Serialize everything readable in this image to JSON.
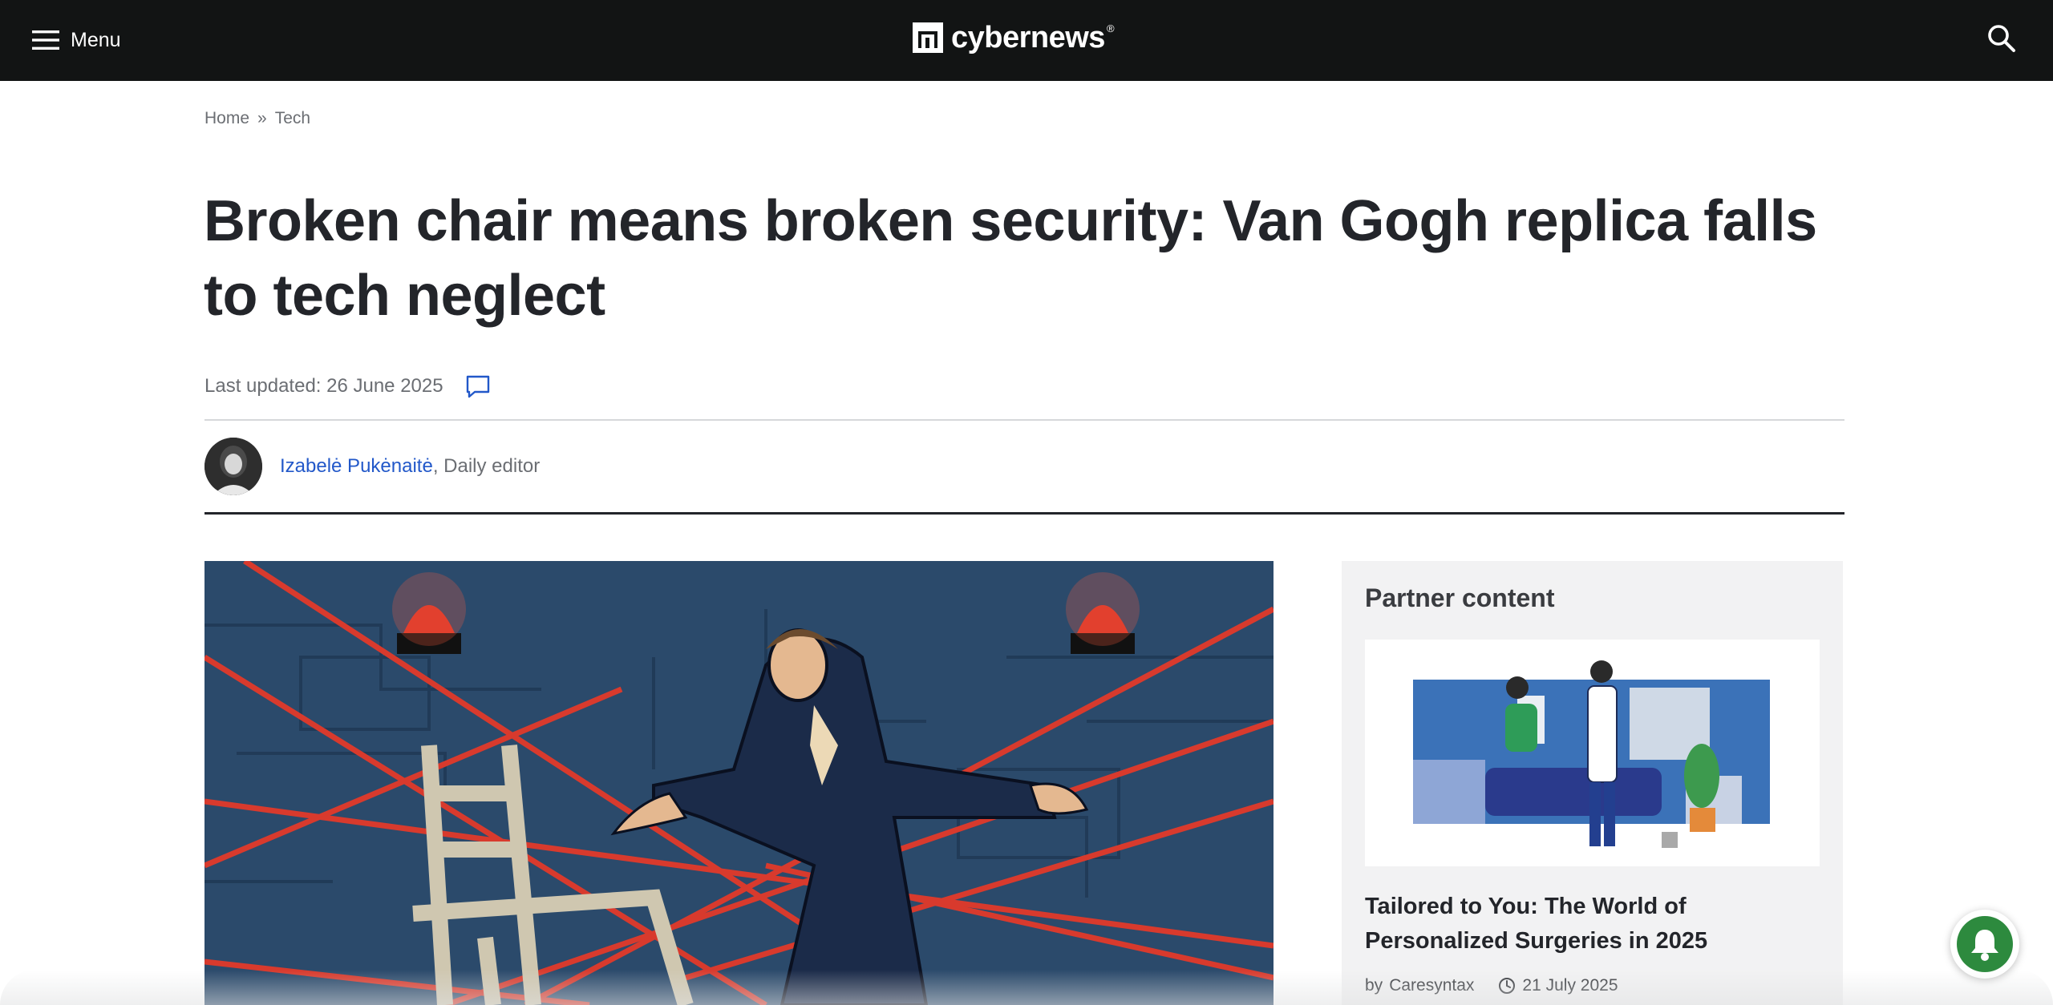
{
  "header": {
    "menu_label": "Menu",
    "logo_text": "cybernews",
    "logo_reg": "®"
  },
  "breadcrumb": {
    "home": "Home",
    "separator": "»",
    "section": "Tech"
  },
  "article": {
    "title": "Broken chair means broken security: Van Gogh replica falls to tech neglect",
    "last_updated": "Last updated: 26 June 2025",
    "author_name": "Izabelė Pukėnaitė",
    "author_role": ", Daily editor"
  },
  "sidebar": {
    "heading": "Partner content",
    "card_title": "Tailored to You: The World of Personalized Surgeries in 2025",
    "by_label": "by",
    "card_source": "Caresyntax",
    "card_date": "21 July 2025"
  },
  "colors": {
    "header_bg": "#121414",
    "link_blue": "#2258c9",
    "bell_green": "#2d8a3e",
    "text_dark": "#23252a"
  },
  "icons": {
    "menu": "hamburger-icon",
    "search": "search-icon",
    "comment": "comment-icon",
    "clock": "clock-icon",
    "bell": "bell-icon"
  }
}
